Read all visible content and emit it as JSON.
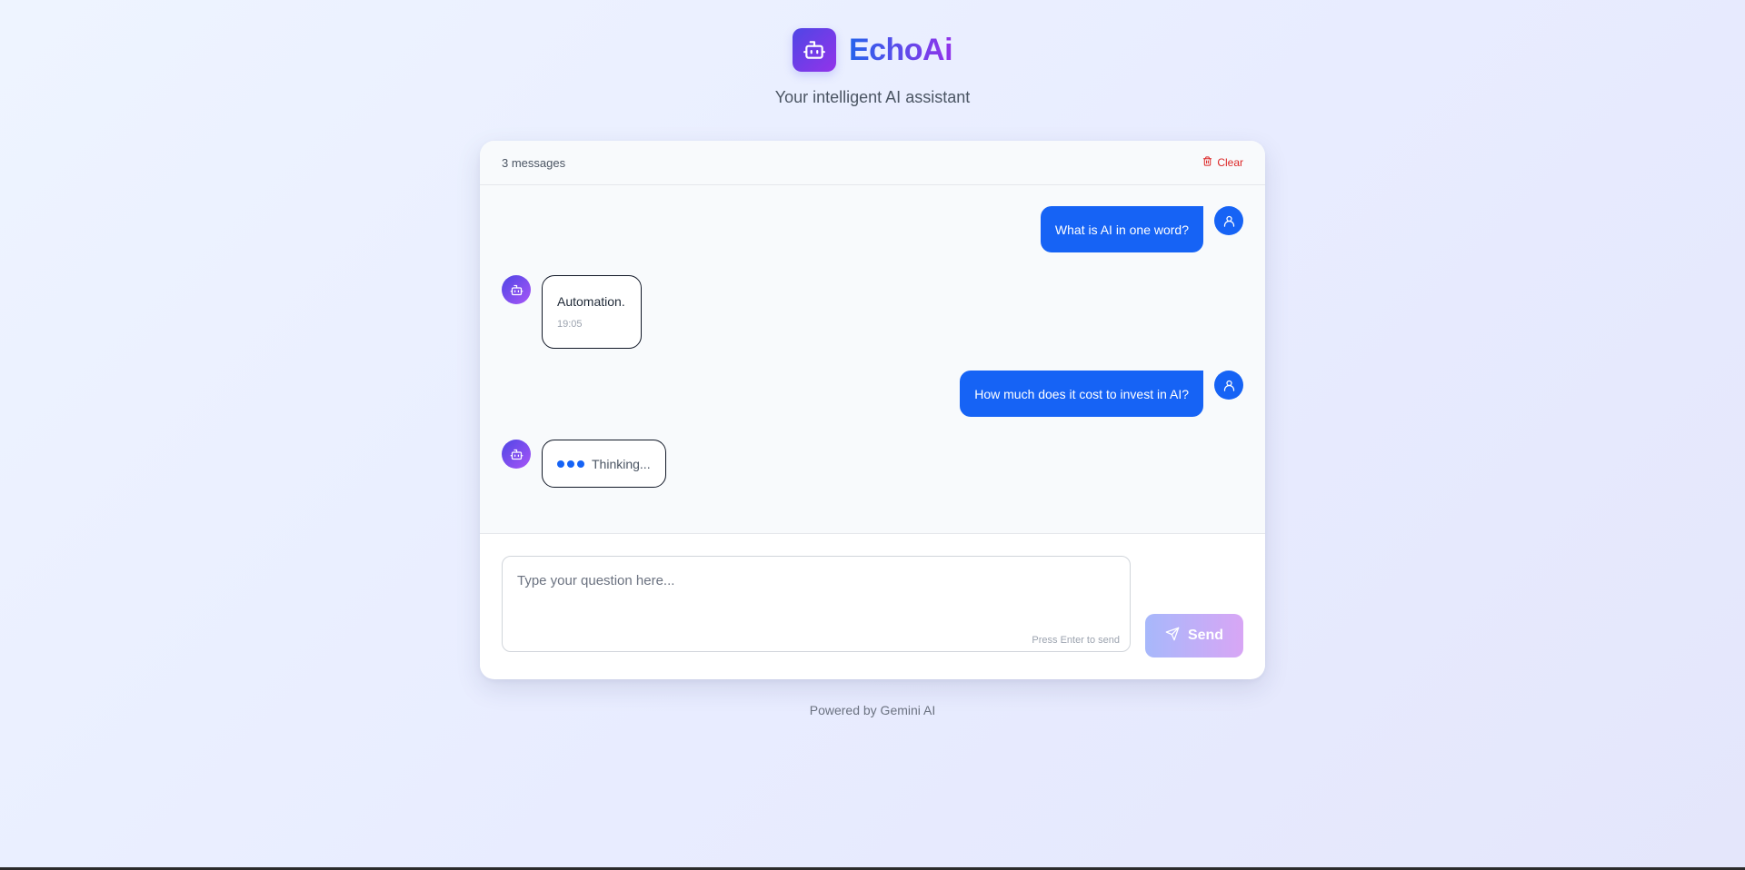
{
  "app": {
    "name": "EchoAi",
    "tagline": "Your intelligent AI assistant"
  },
  "chat": {
    "count_label": "3 messages",
    "clear_label": "Clear",
    "messages": [
      {
        "role": "user",
        "text": "What is AI in one word?"
      },
      {
        "role": "assistant",
        "text": "Automation.",
        "time": "19:05"
      },
      {
        "role": "user",
        "text": "How much does it cost to invest in AI?"
      },
      {
        "role": "assistant",
        "status": "Thinking..."
      }
    ]
  },
  "composer": {
    "placeholder": "Type your question here...",
    "value": "",
    "hint": "Press Enter to send",
    "send_label": "Send"
  },
  "footer": {
    "text": "Powered by Gemini AI"
  },
  "icons": {
    "logo": "robot-icon",
    "clear": "trash-icon",
    "user_avatar": "user-icon",
    "bot_avatar": "robot-icon",
    "send": "send-icon"
  },
  "colors": {
    "primary": "#1663f5",
    "brand_gradient_start": "#4f46e5",
    "brand_gradient_end": "#9333ea",
    "danger": "#dc2626"
  }
}
